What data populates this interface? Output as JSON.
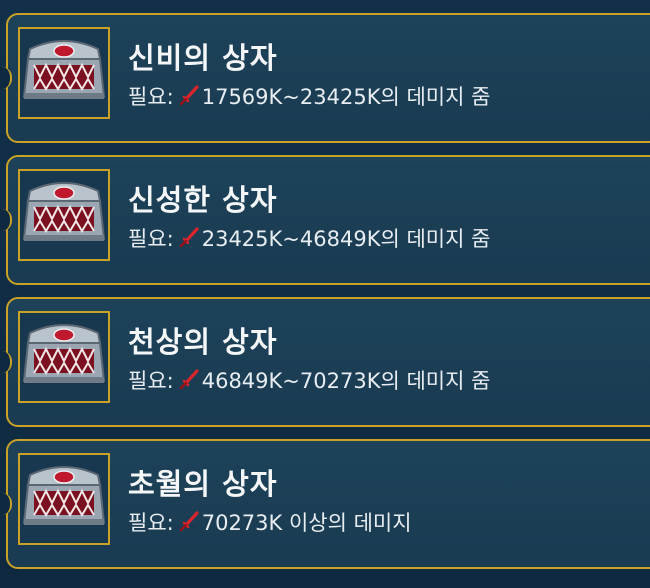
{
  "boxes": [
    {
      "title": "신비의 상자",
      "req_label": "필요:",
      "req_value": "17569K~23425K의 데미지 줌",
      "icon": "treasure-chest-icon",
      "req_icon": "sword-icon"
    },
    {
      "title": "신성한 상자",
      "req_label": "필요:",
      "req_value": "23425K~46849K의 데미지 줌",
      "icon": "treasure-chest-icon",
      "req_icon": "sword-icon"
    },
    {
      "title": "천상의 상자",
      "req_label": "필요:",
      "req_value": "46849K~70273K의 데미지 줌",
      "icon": "treasure-chest-icon",
      "req_icon": "sword-icon"
    },
    {
      "title": "초월의 상자",
      "req_label": "필요:",
      "req_value": "70273K 이상의 데미지",
      "icon": "treasure-chest-icon",
      "req_icon": "sword-icon"
    }
  ],
  "colors": {
    "border": "#c9a227",
    "card_bg": "#1d4259",
    "text": "#f4f6f8",
    "sword": "#d9262c"
  }
}
